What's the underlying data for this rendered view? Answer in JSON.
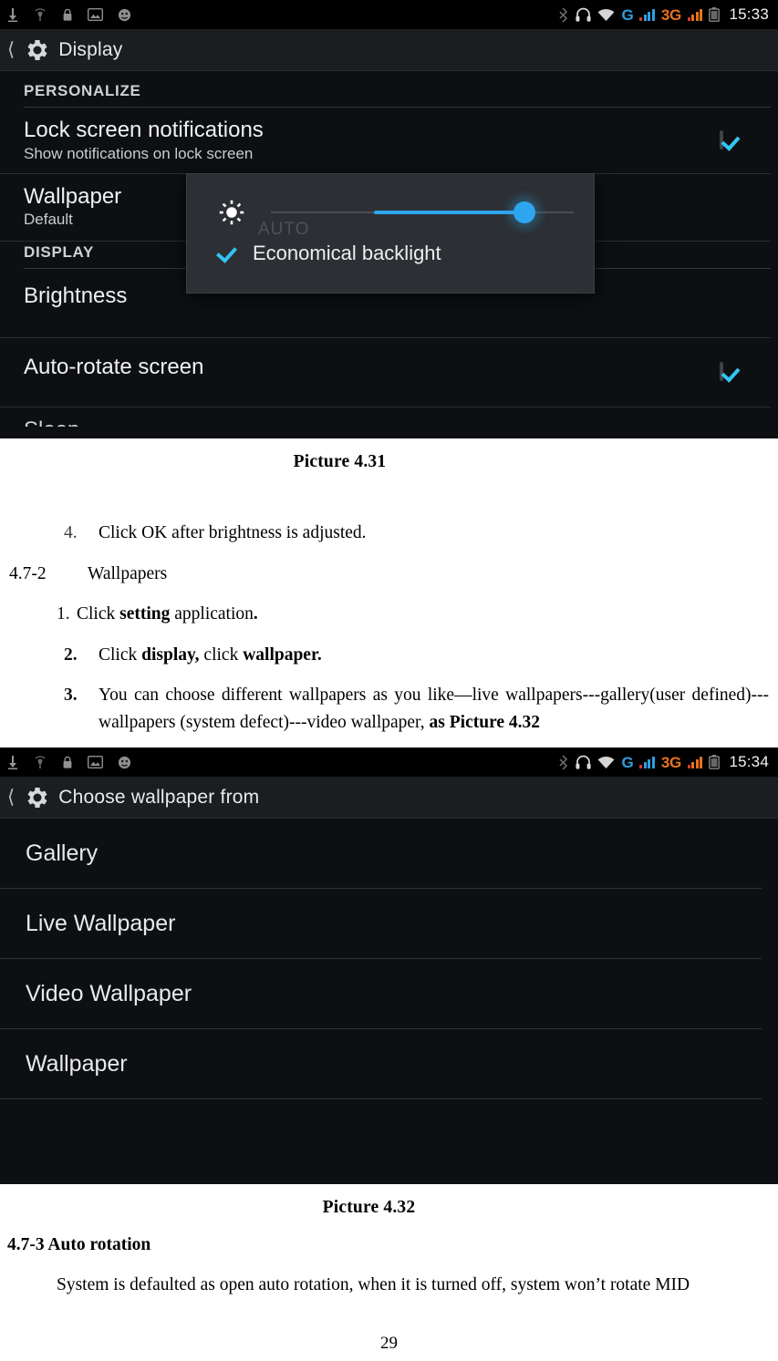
{
  "page": {
    "number": "29"
  },
  "screenshot_display": {
    "status_bar": {
      "left_icons": [
        "download-icon",
        "antenna-icon",
        "lock-icon",
        "screenshot-icon",
        "location-icon"
      ],
      "right_icons": [
        "bluetooth-icon",
        "headset-icon",
        "wifi-icon"
      ],
      "gsm_label": "G",
      "gsm_color": "#2f9fe0",
      "umts_label": "3G",
      "umts_color": "#e8721a",
      "battery_icon": "battery-icon",
      "clock": "15:33"
    },
    "action_bar": {
      "back_icon": "back-caret-icon",
      "app_icon": "gear-icon",
      "title": "Display"
    },
    "sections": [
      {
        "header": "PERSONALIZE",
        "rows": [
          {
            "title": "Lock screen notifications",
            "subtitle": "Show notifications on lock screen",
            "checked": true
          },
          {
            "title": "Wallpaper",
            "subtitle": "Default",
            "checked": false
          }
        ]
      },
      {
        "header": "DISPLAY",
        "rows": [
          {
            "title": "Brightness",
            "subtitle": "",
            "checked": false
          },
          {
            "title": "Auto-rotate screen",
            "subtitle": "",
            "checked": true
          }
        ]
      }
    ],
    "brightness_dialog": {
      "brightness_icon": "sun-icon",
      "auto_label": "AUTO",
      "slider_value_percent": 80,
      "economical_checked": true,
      "economical_label": "Economical backlight",
      "accent_color": "#2ea6ef"
    }
  },
  "caption_431": "Picture 4.31",
  "step_4": {
    "marker": "4.",
    "text": "Click OK after brightness is adjusted."
  },
  "section_472": {
    "number": "4.7-2",
    "title": "Wallpapers"
  },
  "wallpaper_steps": [
    {
      "marker": "1.",
      "pre": "Click ",
      "bold1": "setting",
      "mid": " application",
      "bold2": ".",
      "post": ""
    },
    {
      "marker": "2.",
      "pre": "Click ",
      "bold1": "display,",
      "mid": " click ",
      "bold2": "wallpaper.",
      "post": ""
    }
  ],
  "step_3": {
    "marker": "3.",
    "text": "You can choose different wallpapers as you like—live wallpapers---gallery(user defined)---wallpapers (system defect)---video wallpaper, ",
    "bold_tail": "as Picture 4.32"
  },
  "screenshot_wallpaper": {
    "status_bar": {
      "left_icons": [
        "download-icon",
        "antenna-icon",
        "lock-icon",
        "screenshot-icon",
        "location-icon"
      ],
      "right_icons": [
        "bluetooth-icon",
        "headset-icon",
        "wifi-icon"
      ],
      "gsm_label": "G",
      "gsm_color": "#2f9fe0",
      "umts_label": "3G",
      "umts_color": "#e8721a",
      "battery_icon": "battery-icon",
      "clock": "15:34"
    },
    "action_bar": {
      "back_icon": "back-caret-icon",
      "app_icon": "gear-icon",
      "title": "Choose wallpaper from"
    },
    "items": [
      {
        "label": "Gallery"
      },
      {
        "label": "Live Wallpaper"
      },
      {
        "label": "Video Wallpaper"
      },
      {
        "label": "Wallpaper"
      }
    ]
  },
  "caption_432": "Picture 4.32",
  "section_473": {
    "title": "4.7-3 Auto rotation"
  },
  "auto_rotation_body": "System is defaulted as open auto rotation, when it is turned off, system won’t rotate MID"
}
